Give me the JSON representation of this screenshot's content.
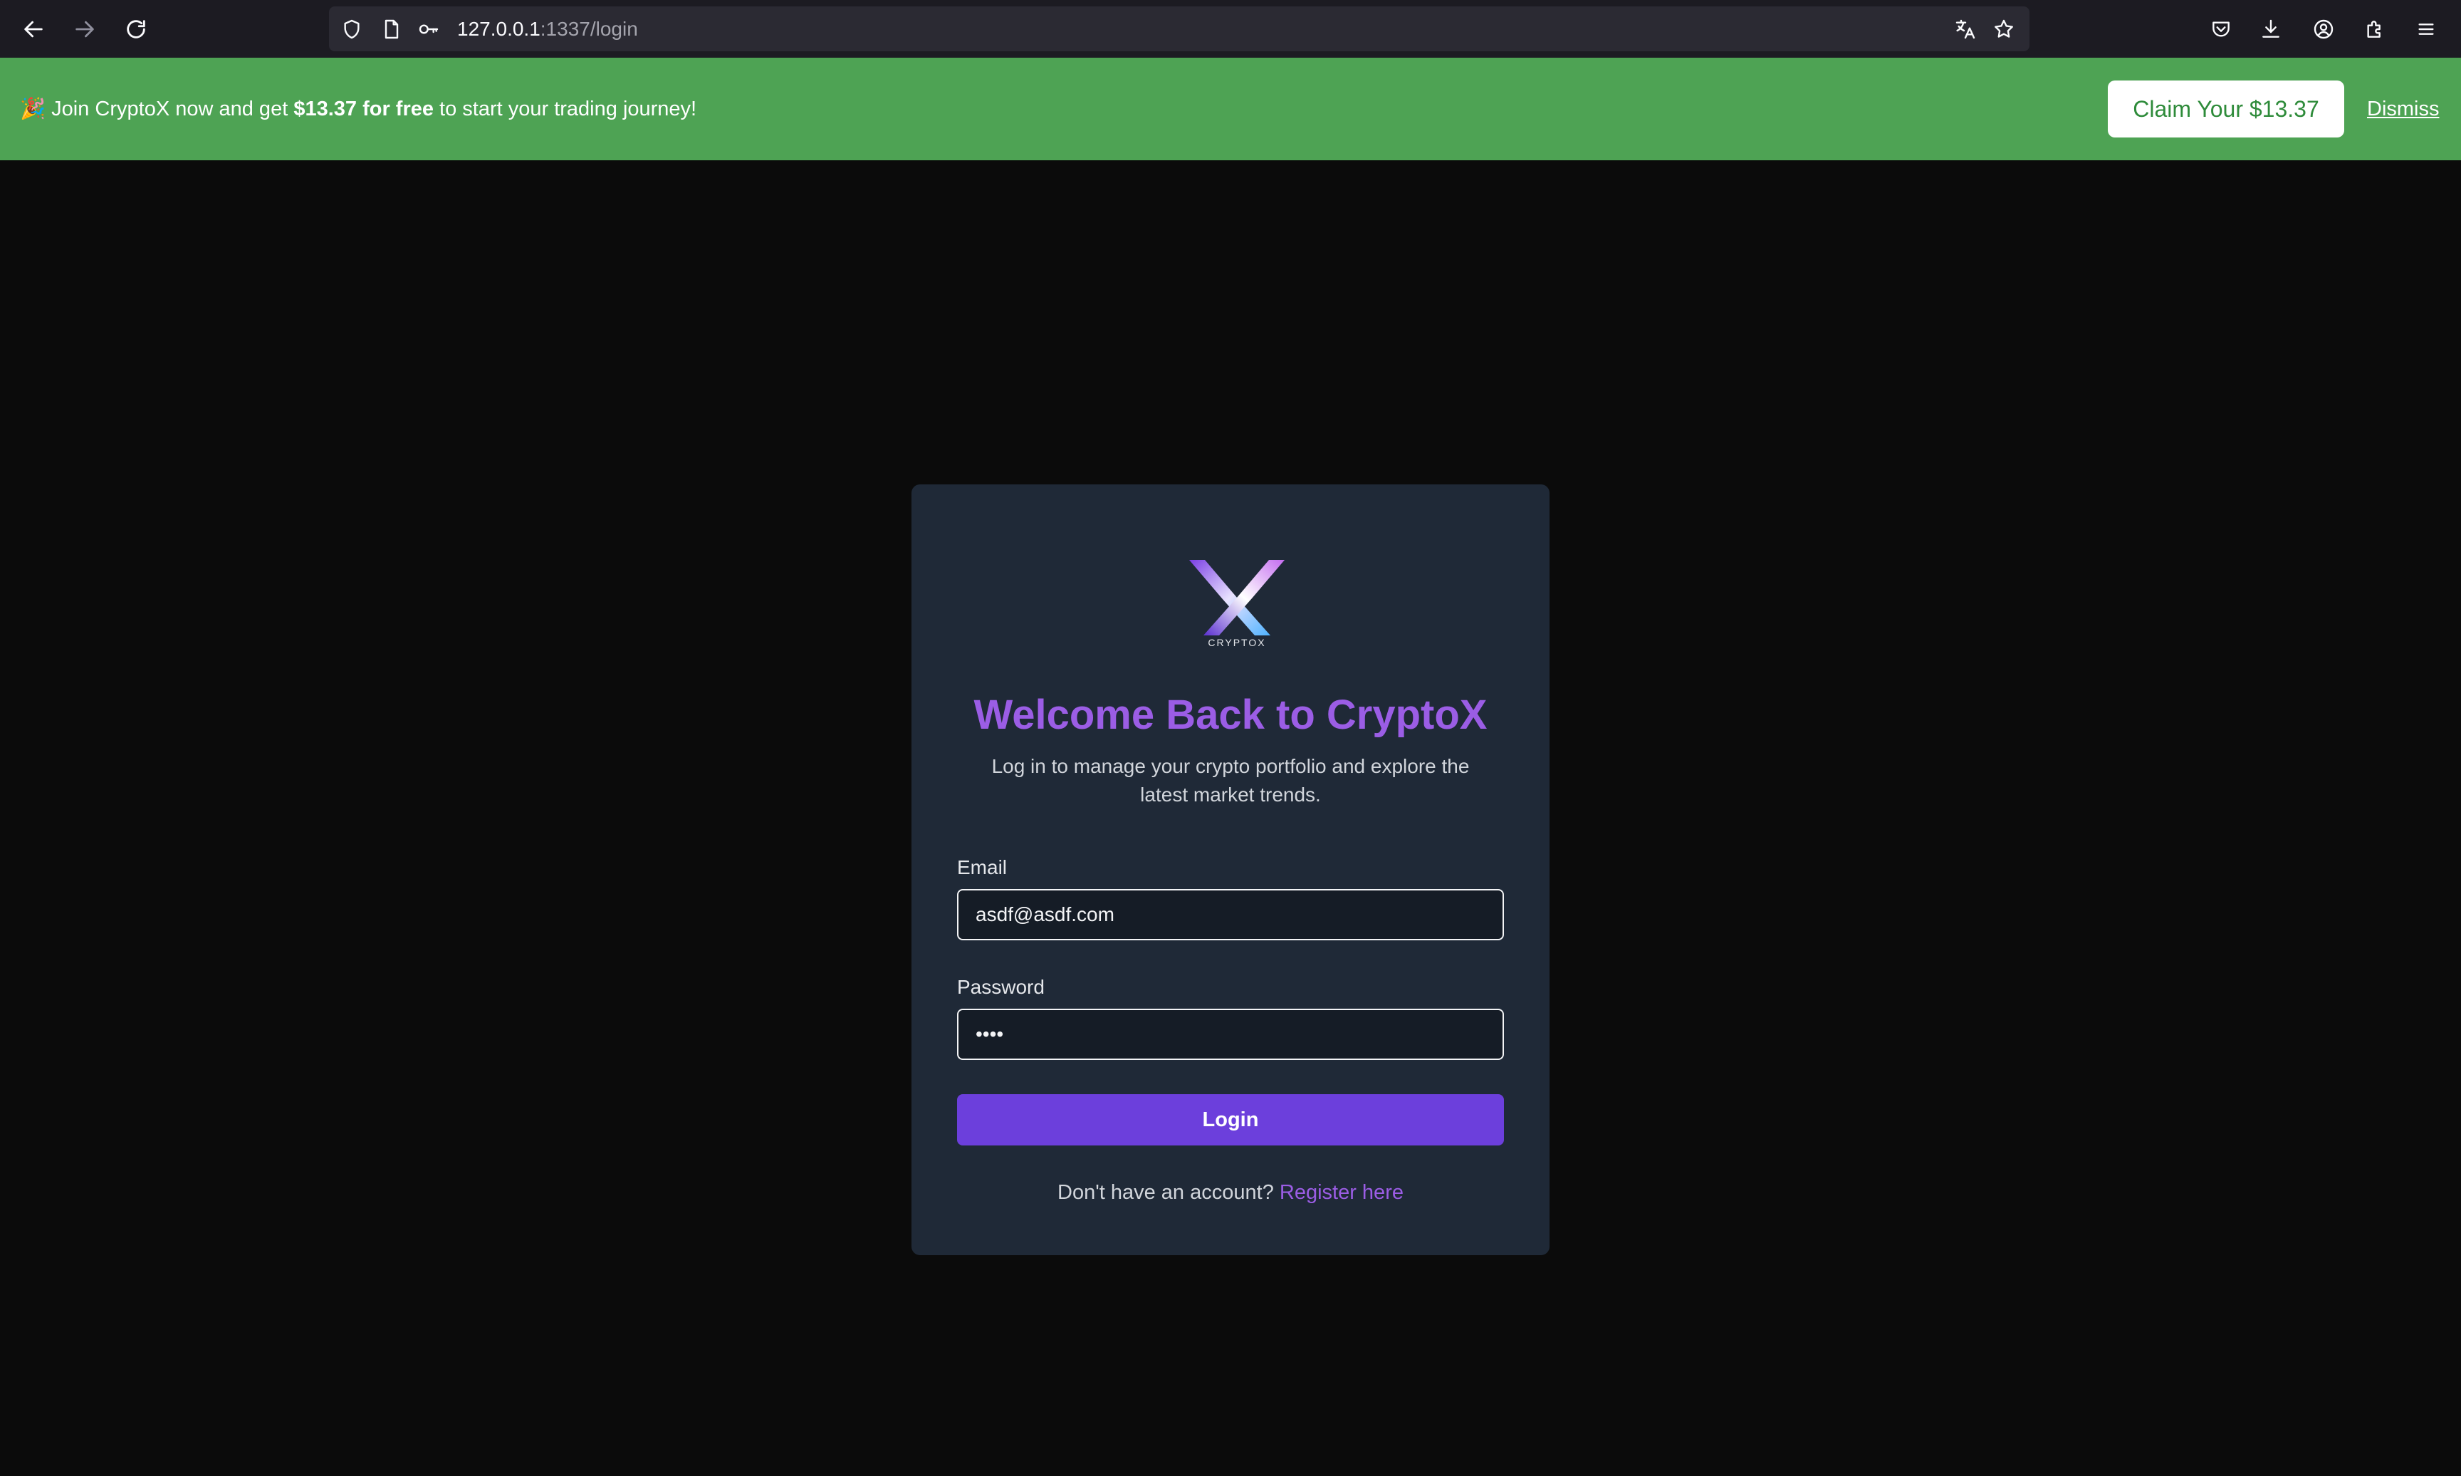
{
  "browser": {
    "url_host": "127.0.0.1",
    "url_path": ":1337/login",
    "icons": {
      "back": "back-arrow-icon",
      "forward": "forward-arrow-icon",
      "reload": "reload-icon",
      "shield": "shield-icon",
      "page": "page-icon",
      "key": "key-icon",
      "translate": "translate-icon",
      "bookmark": "star-icon",
      "pocket": "pocket-icon",
      "downloads": "download-icon",
      "account": "account-icon",
      "extensions": "extensions-icon",
      "menu": "hamburger-menu-icon"
    }
  },
  "banner": {
    "emoji": "🎉",
    "text_before": " Join CryptoX now and get ",
    "text_bold": "$13.37 for free",
    "text_after": " to start your trading journey!",
    "claim_label": "Claim Your $13.37",
    "dismiss_label": "Dismiss",
    "background_color": "#4ea354"
  },
  "login": {
    "logo_text": "CRYPTOX",
    "title": "Welcome Back to CryptoX",
    "subtitle": "Log in to manage your crypto portfolio and explore the latest market trends.",
    "email_label": "Email",
    "email_value": "asdf@asdf.com",
    "password_label": "Password",
    "password_value": "••••",
    "login_button": "Login",
    "register_prompt": "Don't have an account? ",
    "register_link": "Register here",
    "accent_color": "#9b5de5",
    "button_color": "#6c3fdc"
  }
}
